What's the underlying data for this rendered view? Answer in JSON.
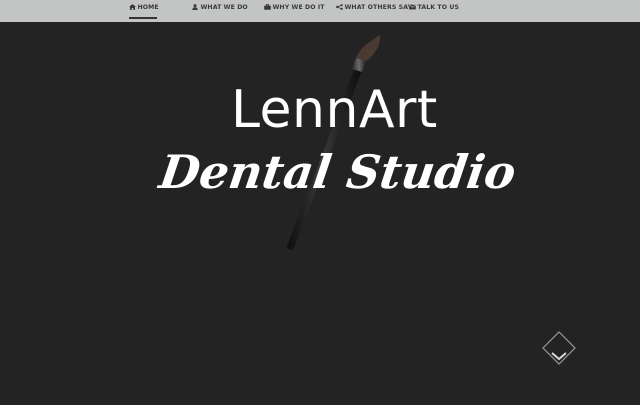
{
  "nav": {
    "items": [
      {
        "label": "HOME",
        "icon": "home-icon",
        "active": true
      },
      {
        "label": "WHAT WE DO",
        "icon": "user-icon",
        "active": false
      },
      {
        "label": "WHY WE DO IT",
        "icon": "briefcase-icon",
        "active": false
      },
      {
        "label": "WHAT OTHERS SAY",
        "icon": "share-icon",
        "active": false
      },
      {
        "label": "TALK TO US",
        "icon": "envelope-icon",
        "active": false
      }
    ]
  },
  "hero": {
    "line1": "LennArt",
    "line2": "Dental Studio",
    "decoration": "paintbrush-icon"
  },
  "scroll": {
    "icon": "chevron-down-icon"
  },
  "colors": {
    "nav_bg": "#c3c4c4",
    "page_bg": "#232323",
    "text": "#ffffff",
    "nav_text": "#3a3a3a"
  }
}
